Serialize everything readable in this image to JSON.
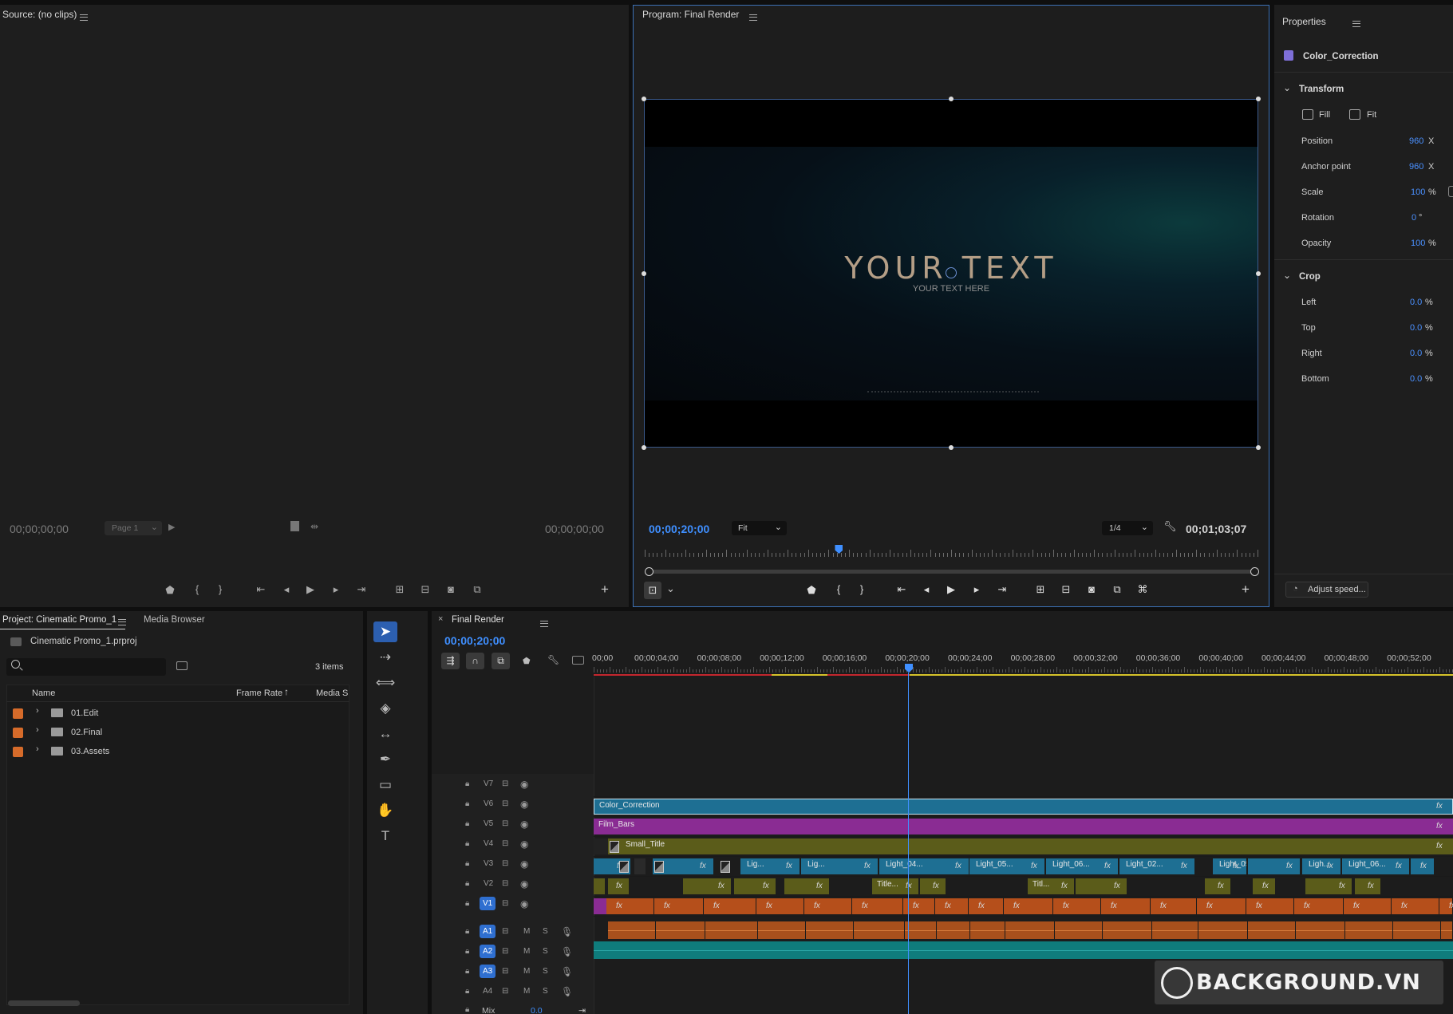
{
  "source": {
    "title": "Source: (no clips)",
    "tc_in": "00;00;00;00",
    "tc_out": "00;00;00;00",
    "page_select": "Page 1"
  },
  "program": {
    "title": "Program: Final Render",
    "tc_current": "00;00;20;00",
    "zoom": "Fit",
    "resolution": "1/4",
    "tc_duration": "00;01;03;07",
    "big_text": "YOUR TEXT",
    "sub_text": "YOUR TEXT HERE",
    "playhead_fraction": 0.317
  },
  "properties": {
    "title": "Properties",
    "clip_name": "Color_Correction",
    "transform_label": "Transform",
    "fill_label": "Fill",
    "fit_label": "Fit",
    "position_label": "Position",
    "position_val": "960",
    "position_unit": "X",
    "anchor_label": "Anchor point",
    "anchor_val": "960",
    "anchor_unit": "X",
    "scale_label": "Scale",
    "scale_val": "100",
    "scale_unit": "%",
    "rotation_label": "Rotation",
    "rotation_val": "0",
    "rotation_unit": "°",
    "opacity_label": "Opacity",
    "opacity_val": "100",
    "opacity_unit": "%",
    "crop_label": "Crop",
    "left_label": "Left",
    "left_val": "0.0",
    "top_label": "Top",
    "top_val": "0.0",
    "right_label": "Right",
    "right_val": "0.0",
    "bottom_label": "Bottom",
    "bottom_val": "0.0",
    "crop_unit": "%",
    "adjust_speed": "Adjust speed..."
  },
  "project": {
    "tab_project": "Project: Cinematic Promo_1",
    "tab_media": "Media Browser",
    "file": "Cinematic Promo_1.prproj",
    "items_count": "3 items",
    "col_name": "Name",
    "col_rate": "Frame Rate",
    "col_media": "Media S",
    "folders": [
      {
        "name": "01.Edit"
      },
      {
        "name": "02.Final"
      },
      {
        "name": "03.Assets"
      }
    ]
  },
  "timeline": {
    "tab": "Final Render",
    "tc": "00;00;20;00",
    "ruler": [
      "00;00",
      "00;00;04;00",
      "00;00;08;00",
      "00;00;12;00",
      "00;00;16;00",
      "00;00;20;00",
      "00;00;24;00",
      "00;00;28;00",
      "00;00;32;00",
      "00;00;36;00",
      "00;00;40;00",
      "00;00;44;00",
      "00;00;48;00",
      "00;00;52;00"
    ],
    "video_tracks": [
      "V7",
      "V6",
      "V5",
      "V4",
      "V3",
      "V2",
      "V1"
    ],
    "audio_tracks": [
      "A1",
      "A2",
      "A3",
      "A4"
    ],
    "mix_label": "Mix",
    "mix_val": "0.0",
    "clip_v6": "Color_Correction",
    "clip_v5": "Film_Bars",
    "clip_v4": "Small_Title",
    "v3_clips": [
      "Lig...",
      "Lig...",
      "Light_04...",
      "Light_05...",
      "Light_06...",
      "Light_02...",
      "Light_05...",
      "Ligh...",
      "Light_06..."
    ],
    "v2_clips": [
      "Title...",
      "Titl..."
    ],
    "fx_label": "fx",
    "m_label": "M",
    "s_label": "S"
  },
  "watermark": "BACKGROUND.VN"
}
